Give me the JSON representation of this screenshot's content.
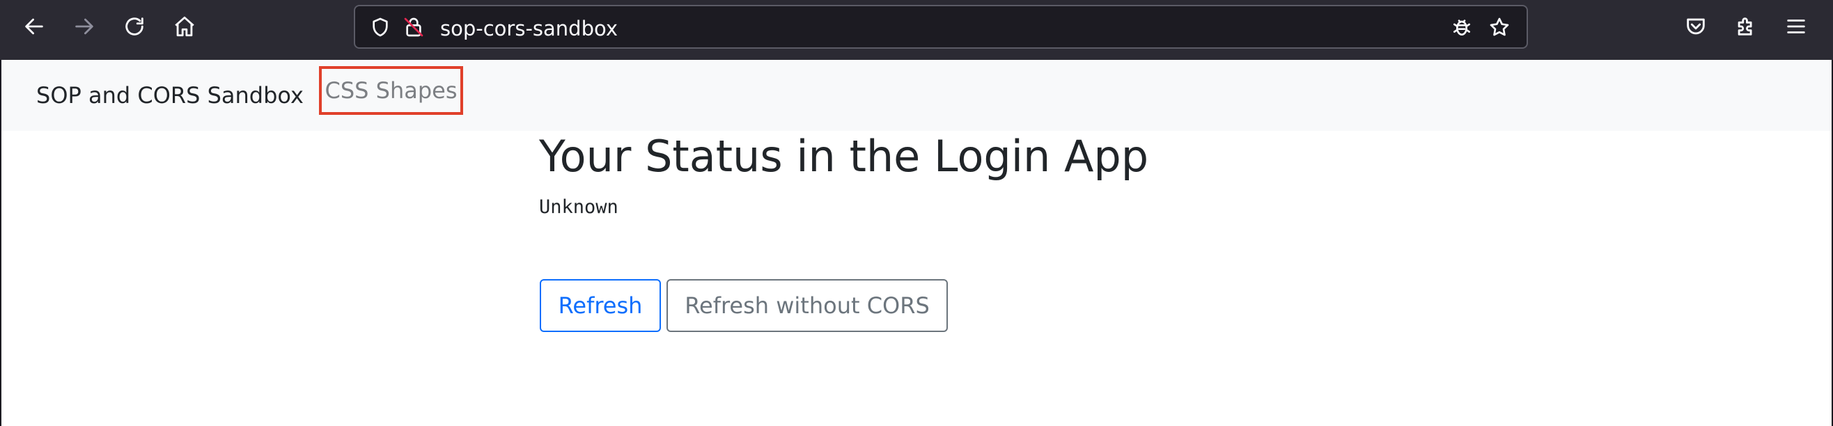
{
  "browser": {
    "url": "sop-cors-sandbox",
    "icons": {
      "back": "back-arrow-icon",
      "forward": "forward-arrow-icon",
      "reload": "reload-icon",
      "home": "home-icon",
      "tracking": "shield-icon",
      "insecure": "insecure-lock-icon",
      "extension": "bug-icon",
      "bookmark": "star-icon",
      "pocket": "pocket-icon",
      "extensions": "puzzle-icon",
      "menu": "hamburger-menu-icon"
    }
  },
  "navbar": {
    "brand": "SOP and CORS Sandbox",
    "link": "CSS Shapes",
    "highlight_color": "#e0402a"
  },
  "main": {
    "heading": "Your Status in the Login App",
    "status": "Unknown",
    "buttons": {
      "refresh": "Refresh",
      "refresh_without_cors": "Refresh without CORS"
    }
  },
  "colors": {
    "toolbar": "#2b2a33",
    "urlbar": "#1c1b22",
    "primary": "#0d6efd",
    "secondary": "#6c757d",
    "navbar": "#f8f9fa"
  }
}
